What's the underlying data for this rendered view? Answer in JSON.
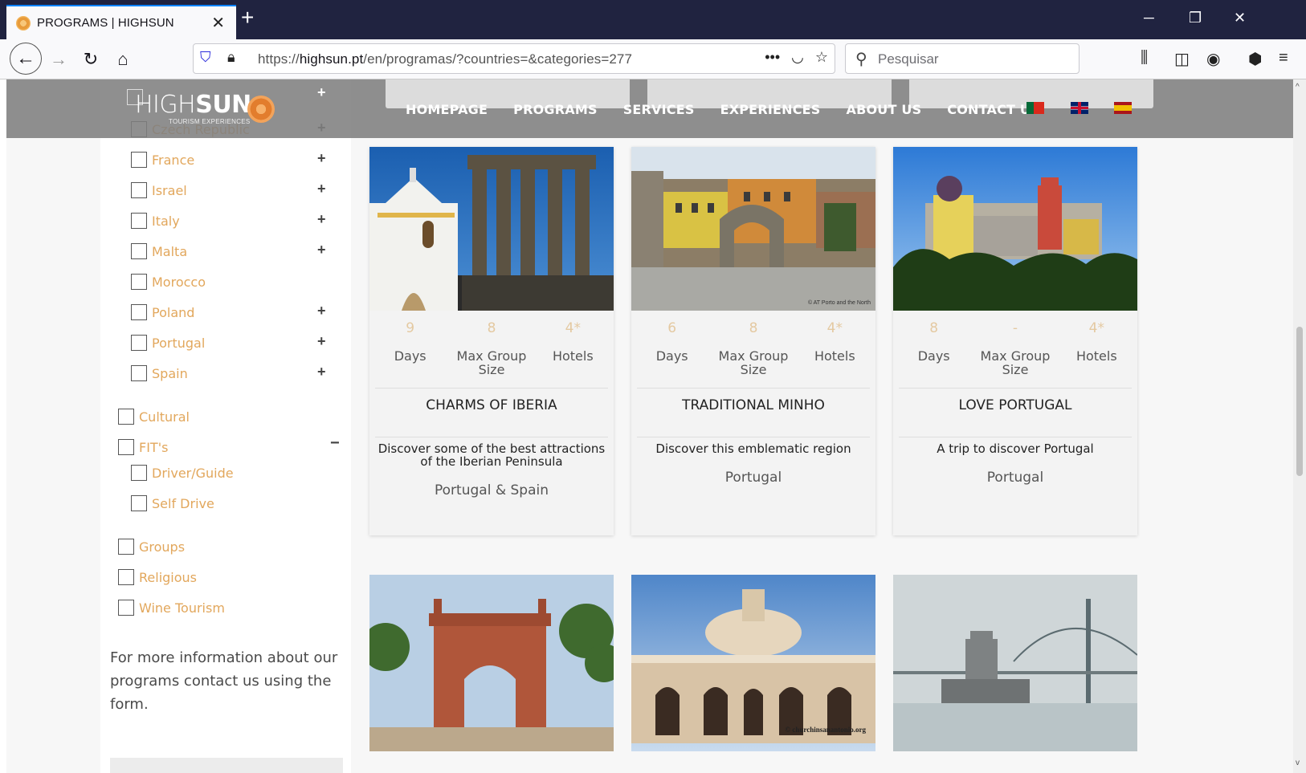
{
  "browser": {
    "tab_title": "PROGRAMS | HIGHSUN",
    "tab_close": "✕",
    "new_tab": "+",
    "url_prefix": "https://",
    "url_host": "highsun.pt",
    "url_path": "/en/programas/?countries=&categories=277",
    "search_placeholder": "Pesquisar",
    "icons": [
      "back-icon",
      "forward-icon",
      "reload-icon",
      "home-icon",
      "tracking-shield-icon",
      "lock-icon",
      "more-icon",
      "pocket-icon",
      "bookmark-star-icon",
      "search-icon",
      "library-icon",
      "sidebar-icon",
      "account-icon",
      "extensions-icon",
      "menu-icon"
    ]
  },
  "header": {
    "logo_light": "HIGH",
    "logo_bold": "SUN",
    "logo_sub": "TOURISM EXPERIENCES",
    "menu": [
      "HOMEPAGE",
      "PROGRAMS",
      "SERVICES",
      "EXPERIENCES",
      "ABOUT US",
      "CONTACT US"
    ],
    "flags": [
      "portugal-flag",
      "uk-flag",
      "spain-flag"
    ]
  },
  "sidebar": {
    "countries": [
      {
        "label": "Czech Republic",
        "expandable": true
      },
      {
        "label": "France",
        "expandable": true
      },
      {
        "label": "Israel",
        "expandable": true
      },
      {
        "label": "Italy",
        "expandable": true
      },
      {
        "label": "Malta",
        "expandable": true
      },
      {
        "label": "Morocco",
        "expandable": false
      },
      {
        "label": "Poland",
        "expandable": true
      },
      {
        "label": "Portugal",
        "expandable": true
      },
      {
        "label": "Spain",
        "expandable": true
      }
    ],
    "categories": [
      {
        "label": "Cultural"
      },
      {
        "label": "FIT's",
        "expanded": true,
        "children": [
          "Driver/Guide",
          "Self Drive"
        ]
      },
      {
        "label": "Groups"
      },
      {
        "label": "Religious"
      },
      {
        "label": "Wine Tourism"
      }
    ],
    "info_text": "For more information about our programs contact us using the form."
  },
  "stat_labels": {
    "days": "Days",
    "group_line1": "Max Group",
    "group_line2": "Size",
    "hotels": "Hotels"
  },
  "cards": [
    {
      "days": "9",
      "group": "8",
      "hotels": "4*",
      "title": "CHARMS OF IBERIA",
      "desc_line1": "Discover some of the best attractions",
      "desc_line2": "of the Iberian Peninsula",
      "country": "Portugal & Spain"
    },
    {
      "days": "6",
      "group": "8",
      "hotels": "4*",
      "title": "TRADITIONAL MINHO",
      "desc_line1": "Discover this emblematic region",
      "desc_line2": "",
      "country": "Portugal",
      "watermark": "© AT Porto and the North"
    },
    {
      "days": "8",
      "group": "-",
      "hotels": "4*",
      "title": "LOVE PORTUGAL",
      "desc_line1": "A trip to discover Portugal",
      "desc_line2": "",
      "country": "Portugal"
    }
  ],
  "bottom_cards": [
    {
      "image": "arc-de-triomf-barcelona"
    },
    {
      "image": "church-san-antonio",
      "watermark": "© churchinsanantonio.org"
    },
    {
      "image": "belem-tower-lisbon"
    }
  ]
}
